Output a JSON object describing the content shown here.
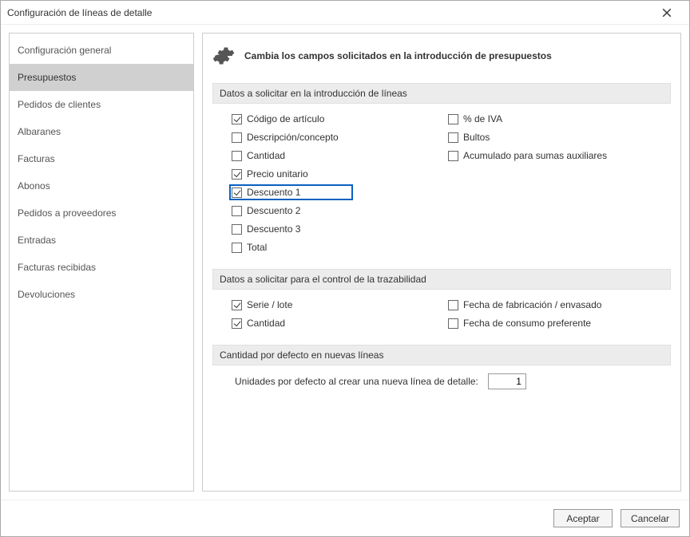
{
  "window": {
    "title": "Configuración de líneas de detalle"
  },
  "sidebar": {
    "items": [
      {
        "label": "Configuración general"
      },
      {
        "label": "Presupuestos"
      },
      {
        "label": "Pedidos de clientes"
      },
      {
        "label": "Albaranes"
      },
      {
        "label": "Facturas"
      },
      {
        "label": "Abonos"
      },
      {
        "label": "Pedidos a proveedores"
      },
      {
        "label": "Entradas"
      },
      {
        "label": "Facturas recibidas"
      },
      {
        "label": "Devoluciones"
      }
    ],
    "selected_index": 1
  },
  "main": {
    "header": "Cambia los campos solicitados en la introducción de presupuestos",
    "section1": {
      "title": "Datos a solicitar en la introducción de líneas",
      "left": [
        {
          "label": "Código de artículo",
          "checked": true,
          "highlight": false
        },
        {
          "label": "Descripción/concepto",
          "checked": false,
          "highlight": false
        },
        {
          "label": "Cantidad",
          "checked": false,
          "highlight": false
        },
        {
          "label": "Precio unitario",
          "checked": true,
          "highlight": false
        },
        {
          "label": "Descuento 1",
          "checked": true,
          "highlight": true
        },
        {
          "label": "Descuento 2",
          "checked": false,
          "highlight": false
        },
        {
          "label": "Descuento 3",
          "checked": false,
          "highlight": false
        },
        {
          "label": "Total",
          "checked": false,
          "highlight": false
        }
      ],
      "right": [
        {
          "label": "% de IVA",
          "checked": false
        },
        {
          "label": "Bultos",
          "checked": false
        },
        {
          "label": "Acumulado para sumas auxiliares",
          "checked": false
        }
      ]
    },
    "section2": {
      "title": "Datos a solicitar para el control de la trazabilidad",
      "left": [
        {
          "label": "Serie / lote",
          "checked": true
        },
        {
          "label": "Cantidad",
          "checked": true
        }
      ],
      "right": [
        {
          "label": "Fecha de fabricación / envasado",
          "checked": false
        },
        {
          "label": "Fecha de consumo preferente",
          "checked": false
        }
      ]
    },
    "section3": {
      "title": "Cantidad por defecto en nuevas líneas",
      "field_label": "Unidades por defecto al crear una nueva línea de detalle:",
      "field_value": "1"
    }
  },
  "footer": {
    "accept": "Aceptar",
    "cancel": "Cancelar"
  }
}
